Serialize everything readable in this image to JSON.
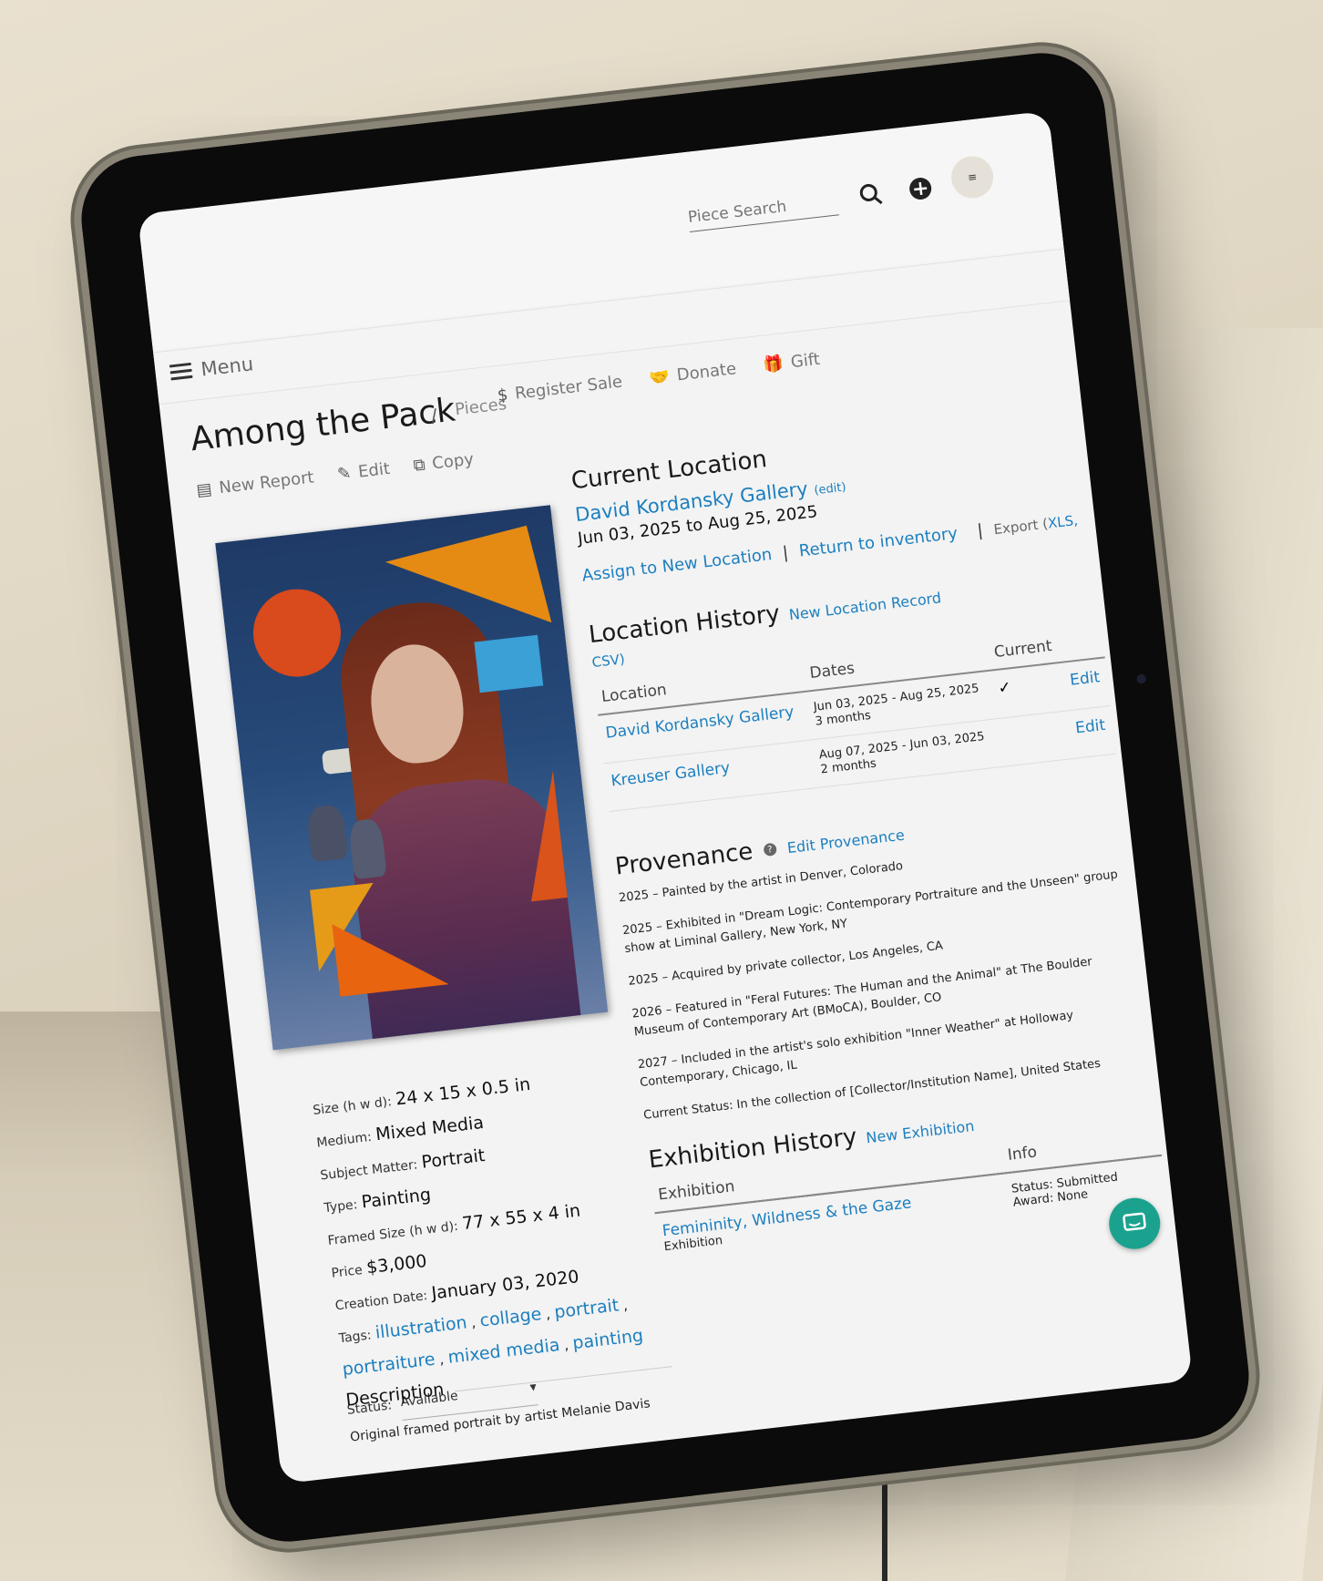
{
  "header": {
    "search_placeholder": "Piece Search",
    "menu_label": "Menu"
  },
  "piece": {
    "title": "Among the Pack",
    "breadcrumb": "Pieces",
    "actions_row1": [
      "Register Sale",
      "Donate",
      "Gift"
    ],
    "actions_row2": [
      "New Report",
      "Edit",
      "Copy"
    ]
  },
  "details": {
    "size_label": "Size (h w d):",
    "size_value": "24 x 15 x 0.5 in",
    "medium_label": "Medium:",
    "medium_value": "Mixed Media",
    "subject_label": "Subject Matter:",
    "subject_value": "Portrait",
    "type_label": "Type:",
    "type_value": "Painting",
    "framed_label": "Framed Size (h w d):",
    "framed_value": "77 x 55 x 4 in",
    "price_label": "Price",
    "price_value": "$3,000",
    "creation_label": "Creation Date:",
    "creation_value": "January 03, 2020",
    "tags_label": "Tags:",
    "tags": [
      "illustration",
      "collage",
      "portrait",
      "portraiture",
      "mixed media",
      "painting"
    ],
    "status_label": "Status:",
    "status_value": "Available",
    "description_heading": "Description",
    "description_text": "Original framed portrait by artist Melanie Davis"
  },
  "current_location": {
    "heading": "Current Location",
    "name": "David Kordansky Gallery",
    "edit_label": "(edit)",
    "dates": "Jun 03, 2025 to Aug 25, 2025",
    "assign_label": "Assign to New Location",
    "return_label": "Return to inventory",
    "export_label": "Export (",
    "export_xls": "XLS,",
    "export_csv": "CSV)"
  },
  "location_history": {
    "heading": "Location History",
    "new_record_label": "New Location Record",
    "columns": [
      "Location",
      "Dates",
      "Current",
      ""
    ],
    "rows": [
      {
        "location": "David Kordansky Gallery",
        "dates": "Jun 03, 2025 - Aug 25, 2025",
        "duration": "3 months",
        "current": "✓",
        "action": "Edit"
      },
      {
        "location": "Kreuser Gallery",
        "dates": "Aug 07, 2025 - Jun 03, 2025",
        "duration": "2 months",
        "current": "",
        "action": "Edit"
      }
    ]
  },
  "provenance": {
    "heading": "Provenance",
    "edit_label": "Edit Provenance",
    "entries": [
      "2025 – Painted by the artist in Denver, Colorado",
      "2025 – Exhibited in \"Dream Logic: Contemporary Portraiture and the Unseen\" group show at Liminal Gallery, New York, NY",
      "2025 – Acquired by private collector, Los Angeles, CA",
      "2026 – Featured in \"Feral Futures: The Human and the Animal\" at The Boulder Museum of Contemporary Art (BMoCA), Boulder, CO",
      "2027 – Included in the artist's solo exhibition \"Inner Weather\" at Holloway Contemporary, Chicago, IL",
      "Current Status: In the collection of [Collector/Institution Name], United States"
    ]
  },
  "exhibition_history": {
    "heading": "Exhibition History",
    "new_label": "New Exhibition",
    "columns": [
      "Exhibition",
      "Info"
    ],
    "rows": [
      {
        "name": "Femininity, Wildness & the Gaze",
        "kind": "Exhibition",
        "status": "Status: Submitted",
        "award": "Award: None"
      }
    ]
  }
}
